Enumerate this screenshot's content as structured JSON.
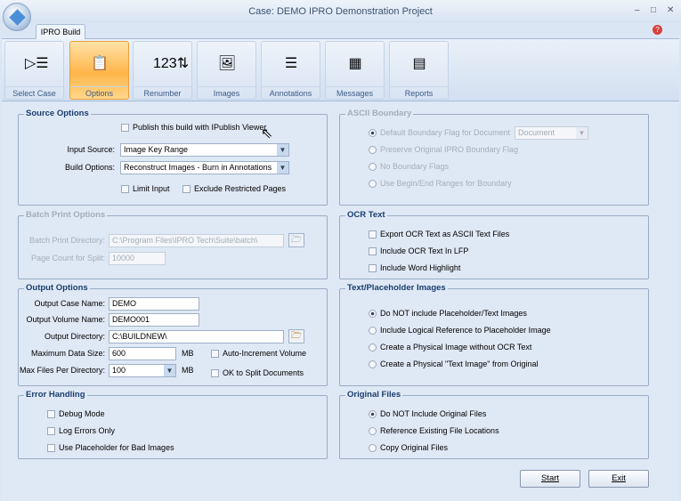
{
  "window": {
    "title": "Case: DEMO  IPRO Demonstration Project",
    "minimize": "–",
    "restore": "□",
    "close": "✕",
    "help": "?"
  },
  "tab": "IPRO Build",
  "ribbon": [
    {
      "label": "Select Case",
      "icon": "select-case-icon",
      "glyph": "▷☰"
    },
    {
      "label": "Options",
      "icon": "clipboard-icon",
      "glyph": "📋"
    },
    {
      "label": "Renumber",
      "icon": "renumber-icon",
      "glyph": "123⇅"
    },
    {
      "label": "Images",
      "icon": "image-icon",
      "glyph": "🖼"
    },
    {
      "label": "Annotations",
      "icon": "annotations-icon",
      "glyph": "☰"
    },
    {
      "label": "Messages",
      "icon": "messages-icon",
      "glyph": "▦"
    },
    {
      "label": "Reports",
      "icon": "reports-icon",
      "glyph": "▤"
    }
  ],
  "source": {
    "title": "Source Options",
    "publish": "Publish this build with IPublish Viewer",
    "input_source_label": "Input Source:",
    "input_source": "Image Key Range",
    "build_options_label": "Build Options:",
    "build_options": "Reconstruct Images - Burn in Annotations",
    "limit_input": "Limit Input",
    "exclude": "Exclude Restricted Pages"
  },
  "batch": {
    "title": "Batch Print Options",
    "dir_label": "Batch Print Directory:",
    "dir": "C:\\Program Files\\IPRO Tech\\Suite\\batch\\",
    "split_label": "Page Count for Split:",
    "split": "10000"
  },
  "output": {
    "title": "Output Options",
    "case_label": "Output Case Name:",
    "case": "DEMO",
    "volume_label": "Output Volume Name:",
    "volume": "DEMO001",
    "dir_label": "Output Directory:",
    "dir": "C:\\BUILDNEW\\",
    "max_size_label": "Maximum Data Size:",
    "max_size": "600",
    "mb": "MB",
    "max_files_label": "Max Files Per Directory:",
    "max_files": "100",
    "auto_inc": "Auto-Increment Volume",
    "split_docs": "OK to Split Documents"
  },
  "error": {
    "title": "Error Handling",
    "debug": "Debug Mode",
    "log": "Log Errors Only",
    "placeholder": "Use Placeholder for Bad Images"
  },
  "ascii": {
    "title": "ASCII Boundary",
    "default_flag": "Default Boundary Flag for Document",
    "flag_value": "Document",
    "preserve": "Preserve Original IPRO Boundary Flag",
    "none": "No Boundary Flags",
    "begin_end": "Use Begin/End Ranges for Boundary"
  },
  "ocr": {
    "title": "OCR Text",
    "export": "Export OCR Text as ASCII Text Files",
    "lfp": "Include OCR Text In LFP",
    "highlight": "Include Word Highlight"
  },
  "placeholder": {
    "title": "Text/Placeholder Images",
    "opt1": "Do NOT include Placeholder/Text Images",
    "opt2": "Include Logical Reference to Placeholder Image",
    "opt3": "Create a Physical Image without OCR Text",
    "opt4": "Create a Physical \"Text Image\" from Original"
  },
  "original": {
    "title": "Original Files",
    "opt1": "Do NOT Include Original Files",
    "opt2": "Reference Existing File Locations",
    "opt3": "Copy Original Files"
  },
  "buttons": {
    "start": "Start",
    "exit": "Exit"
  }
}
